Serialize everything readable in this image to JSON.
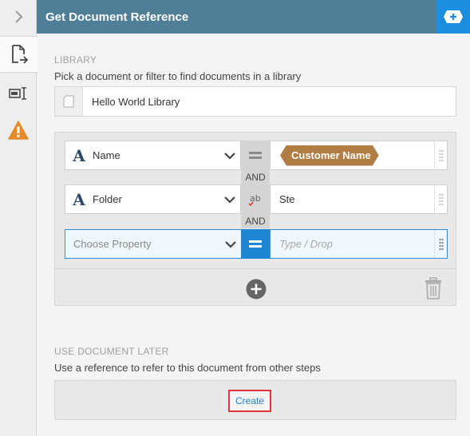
{
  "header": {
    "title": "Get Document Reference",
    "action_icon": "add-icon"
  },
  "rail": {
    "toggle_icon": "chevron-right-icon",
    "tabs": [
      {
        "icon": "document-arrow-icon",
        "active": true
      },
      {
        "icon": "rename-field-icon",
        "active": false
      },
      {
        "icon": "warning-icon",
        "active": false
      }
    ]
  },
  "library": {
    "section_title": "LIBRARY",
    "description": "Pick a document or filter to find documents in a library",
    "value": "Hello World Library"
  },
  "filters": {
    "connector_label": "AND",
    "rows": [
      {
        "property": "Name",
        "operator": "equals-icon",
        "value_token": "Customer Name"
      },
      {
        "property": "Folder",
        "operator": "contains-text-icon",
        "value": "Ste"
      },
      {
        "property_placeholder": "Choose Property",
        "operator": "equals-icon",
        "value_placeholder": "Type / Drop"
      }
    ]
  },
  "use_later": {
    "section_title": "USE DOCUMENT LATER",
    "description": "Use a reference to refer to this document from other steps",
    "create_label": "Create"
  },
  "colors": {
    "header_bg": "#4f7e96",
    "accent_blue": "#1f86d4",
    "token_brown": "#b07d45",
    "warning_orange": "#e48a2a",
    "highlight_red": "#e0363a"
  }
}
